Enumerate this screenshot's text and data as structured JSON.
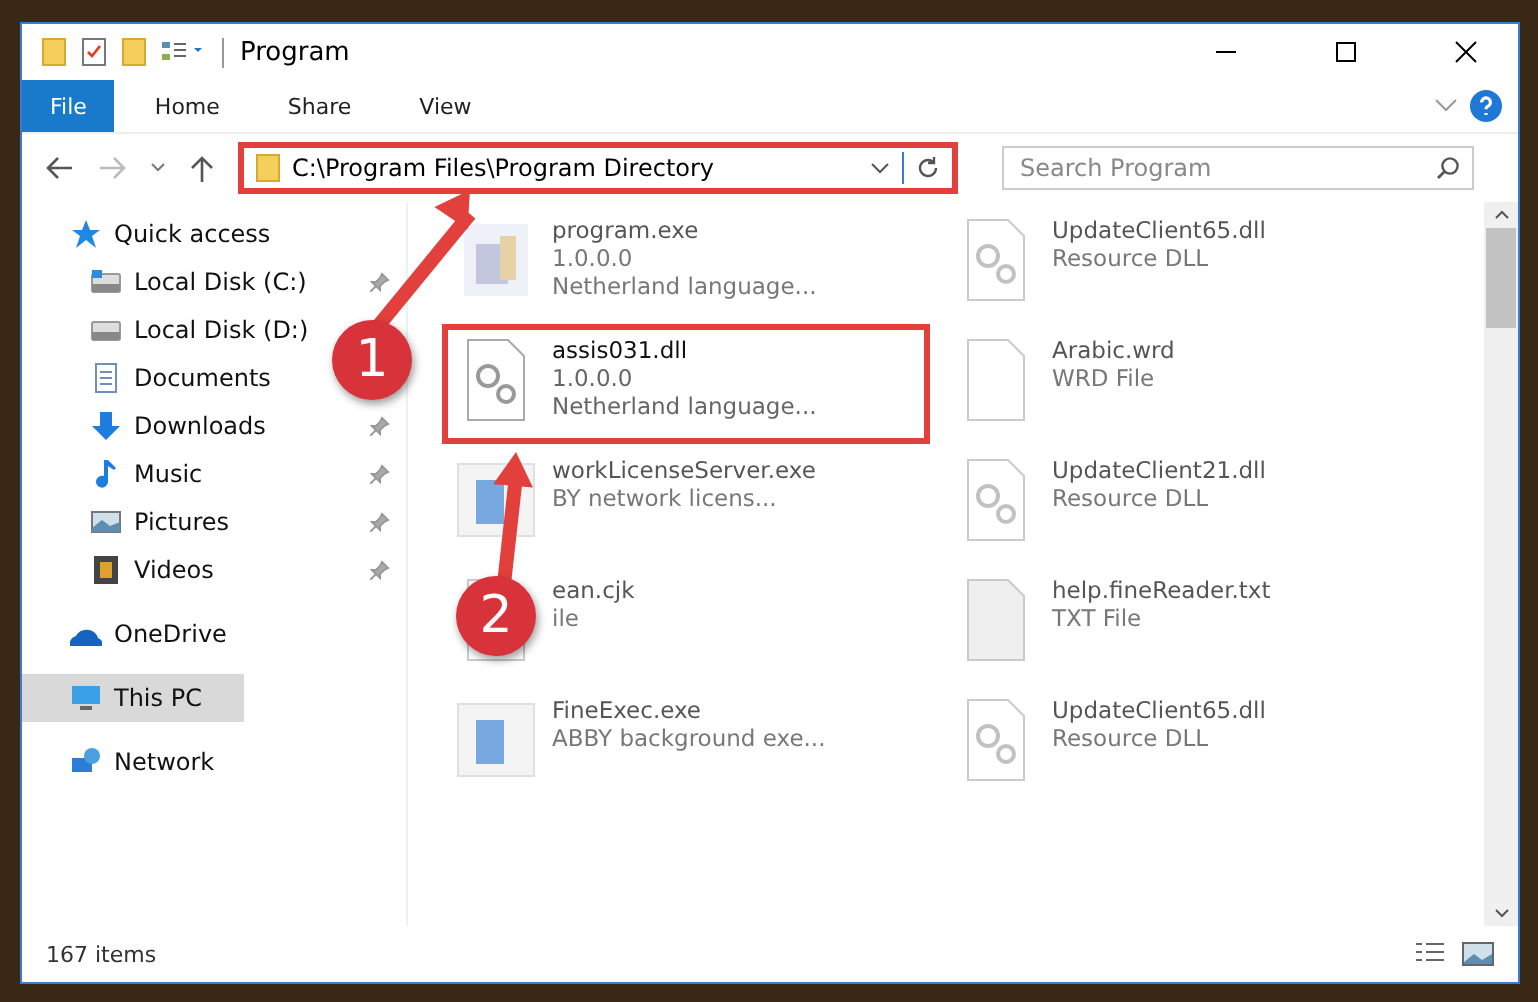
{
  "window": {
    "title": "Program"
  },
  "ribbon": {
    "tabs": [
      {
        "label": "File",
        "selected": true
      },
      {
        "label": "Home",
        "selected": false
      },
      {
        "label": "Share",
        "selected": false
      },
      {
        "label": "View",
        "selected": false
      }
    ]
  },
  "address": {
    "path": "C:\\Program Files\\Program Directory",
    "highlighted": true
  },
  "search": {
    "placeholder": "Search Program"
  },
  "sidebar": {
    "items": [
      {
        "label": "Quick access",
        "kind": "star",
        "selected": false,
        "children": [
          {
            "label": "Local Disk (C:)",
            "kind": "disk-c",
            "selected": false,
            "pinned": true
          },
          {
            "label": "Local Disk (D:)",
            "kind": "disk",
            "selected": false
          },
          {
            "label": "Documents",
            "kind": "docs",
            "selected": false
          },
          {
            "label": "Downloads",
            "kind": "download",
            "selected": false,
            "pinned": true
          },
          {
            "label": "Music",
            "kind": "music",
            "selected": false,
            "pinned": true
          },
          {
            "label": "Pictures",
            "kind": "pictures",
            "selected": false,
            "pinned": true
          },
          {
            "label": "Videos",
            "kind": "videos",
            "selected": false,
            "pinned": true
          }
        ]
      },
      {
        "label": "OneDrive",
        "kind": "cloud",
        "selected": false
      },
      {
        "label": "This PC",
        "kind": "pc",
        "selected": true
      },
      {
        "label": "Network",
        "kind": "network",
        "selected": false
      }
    ]
  },
  "files": [
    {
      "name": "program.exe",
      "lines": [
        "1.0.0.0",
        "Netherland language..."
      ],
      "kind": "exe",
      "faded": true,
      "highlighted": false
    },
    {
      "name": "assis031.dll",
      "lines": [
        "1.0.0.0",
        "Netherland language..."
      ],
      "kind": "gear",
      "faded": false,
      "highlighted": true
    },
    {
      "name": "workLicenseServer.exe",
      "lines": [
        "BY network licens..."
      ],
      "kind": "app",
      "faded": true,
      "highlighted": false
    },
    {
      "name": "ean.cjk",
      "lines": [
        "ile"
      ],
      "kind": "blank",
      "faded": true,
      "highlighted": false
    },
    {
      "name": "FineExec.exe",
      "lines": [
        "ABBY background exe..."
      ],
      "kind": "app",
      "faded": true,
      "highlighted": false
    },
    {
      "name": "UpdateClient65.dll",
      "lines": [
        "Resource DLL"
      ],
      "kind": "gear",
      "faded": true,
      "highlighted": false
    },
    {
      "name": "Arabic.wrd",
      "lines": [
        "WRD File"
      ],
      "kind": "blank",
      "faded": true,
      "highlighted": false
    },
    {
      "name": "UpdateClient21.dll",
      "lines": [
        "Resource DLL"
      ],
      "kind": "gear",
      "faded": true,
      "highlighted": false
    },
    {
      "name": "help.fineReader.txt",
      "lines": [
        "TXT File"
      ],
      "kind": "grey",
      "faded": true,
      "highlighted": false
    },
    {
      "name": "UpdateClient65.dll",
      "lines": [
        "Resource DLL"
      ],
      "kind": "gear",
      "faded": true,
      "highlighted": false
    }
  ],
  "status_bar": {
    "count": "167 items"
  },
  "callouts": [
    {
      "number": "1"
    },
    {
      "number": "2"
    }
  ]
}
